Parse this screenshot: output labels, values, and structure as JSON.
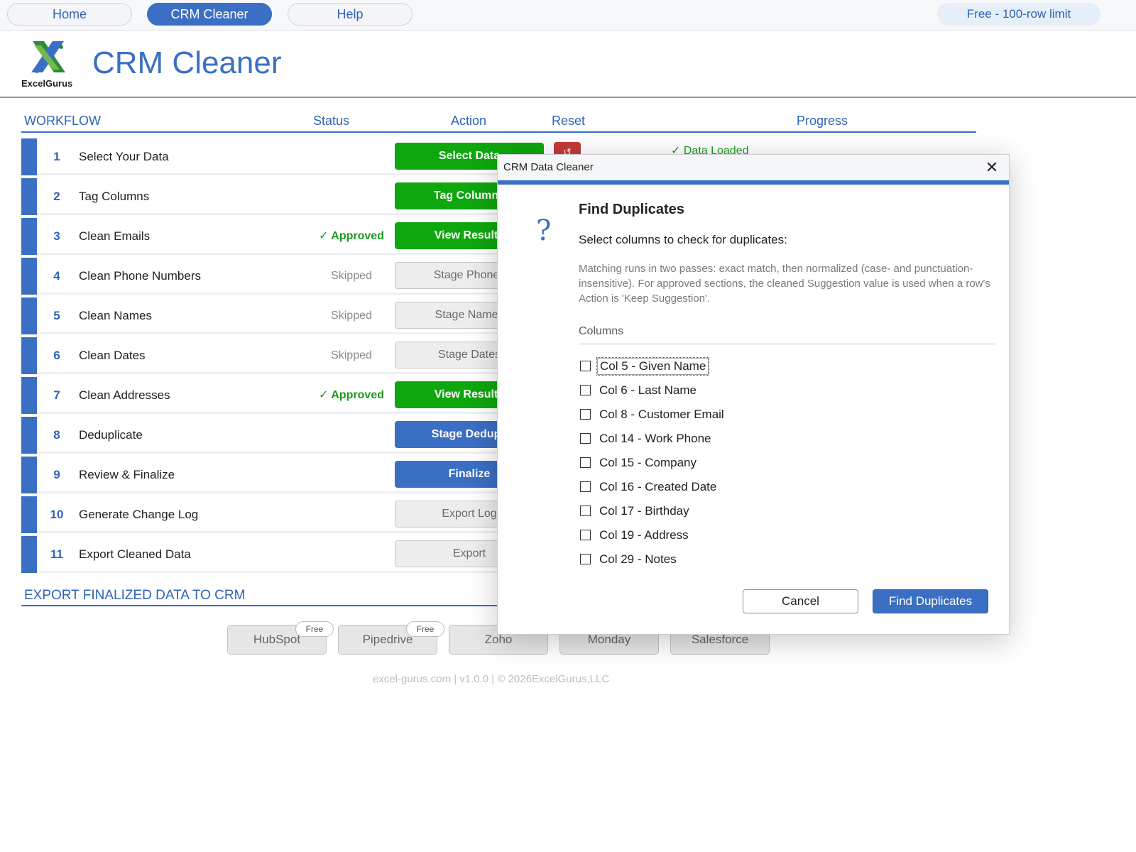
{
  "nav": {
    "home": "Home",
    "crm_cleaner": "CRM Cleaner",
    "help": "Help",
    "plan": "Free - 100-row limit"
  },
  "header": {
    "logo_text": "ExcelGurus",
    "title": "CRM Cleaner"
  },
  "workflow": {
    "columns": {
      "workflow": "WORKFLOW",
      "status": "Status",
      "action": "Action",
      "reset": "Reset",
      "progress": "Progress"
    },
    "progress_text": "✓ Data Loaded",
    "reset_icon": "↺",
    "rows": [
      {
        "num": "1",
        "label": "Select Your Data",
        "status": "",
        "action": "Select Data"
      },
      {
        "num": "2",
        "label": "Tag Columns",
        "status": "",
        "action": "Tag Columns"
      },
      {
        "num": "3",
        "label": "Clean Emails",
        "status": "✓ Approved",
        "action": "View Results"
      },
      {
        "num": "4",
        "label": "Clean Phone Numbers",
        "status": "Skipped",
        "action": "Stage Phones"
      },
      {
        "num": "5",
        "label": "Clean Names",
        "status": "Skipped",
        "action": "Stage Names"
      },
      {
        "num": "6",
        "label": "Clean Dates",
        "status": "Skipped",
        "action": "Stage Dates"
      },
      {
        "num": "7",
        "label": "Clean Addresses",
        "status": "✓ Approved",
        "action": "View Results"
      },
      {
        "num": "8",
        "label": "Deduplicate",
        "status": "",
        "action": "Stage Dedupe"
      },
      {
        "num": "9",
        "label": "Review & Finalize",
        "status": "",
        "action": "Finalize"
      },
      {
        "num": "10",
        "label": "Generate Change Log",
        "status": "",
        "action": "Export Log"
      },
      {
        "num": "11",
        "label": "Export Cleaned Data",
        "status": "",
        "action": "Export"
      }
    ]
  },
  "export": {
    "title": "EXPORT FINALIZED DATA TO CRM",
    "free_label": "Free",
    "crms": [
      "HubSpot",
      "Pipedrive",
      "Zoho",
      "Monday",
      "Salesforce"
    ]
  },
  "footer": "excel-gurus.com  |  v1.0.0  |  © 2026ExcelGurus,LLC",
  "dialog": {
    "title": "CRM Data Cleaner",
    "close_icon": "✕",
    "question_icon": "?",
    "heading": "Find Duplicates",
    "prompt": "Select columns to check for duplicates:",
    "description": "Matching runs in two passes: exact match, then normalized (case- and punctuation-insensitive). For approved sections, the cleaned Suggestion value is used when a row's Action is 'Keep Suggestion'.",
    "columns_header": "Columns",
    "columns": [
      "Col 5 - Given Name",
      "Col 6 - Last Name",
      "Col 8 - Customer Email",
      "Col 14 - Work Phone",
      "Col 15 - Company",
      "Col 16 - Created Date",
      "Col 17 - Birthday",
      "Col 19 - Address",
      "Col 29 - Notes"
    ],
    "cancel": "Cancel",
    "confirm": "Find Duplicates"
  }
}
